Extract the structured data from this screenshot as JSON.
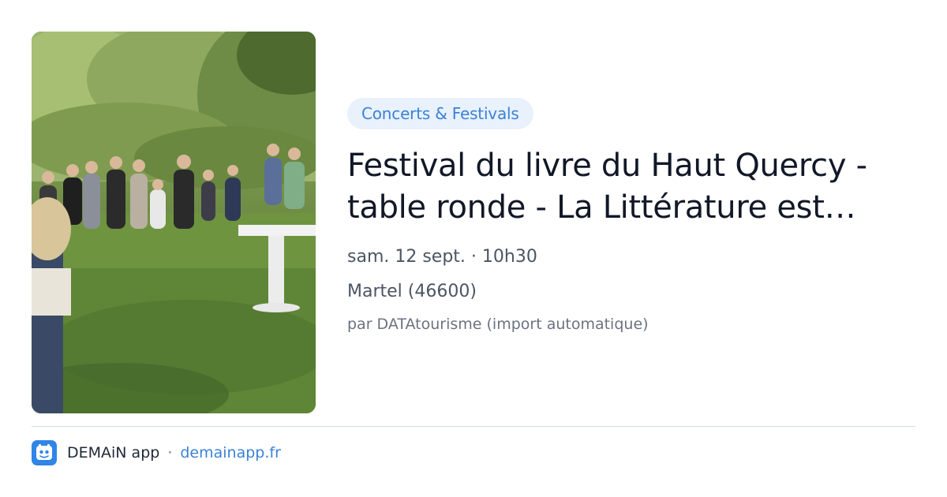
{
  "event": {
    "category": "Concerts & Festivals",
    "title": "Festival du livre du Haut Quercy - table ronde - La Littérature est…",
    "datetime": "sam. 12 sept. · 10h30",
    "location": "Martel (46600)",
    "source": "par DATAtourisme (import automatique)"
  },
  "footer": {
    "app_name": "DEMAiN app",
    "separator": "·",
    "domain": "demainapp.fr"
  },
  "colors": {
    "accent": "#3b82d6",
    "pill_bg": "#e8f1fc",
    "app_icon_bg": "#2f86e6"
  }
}
